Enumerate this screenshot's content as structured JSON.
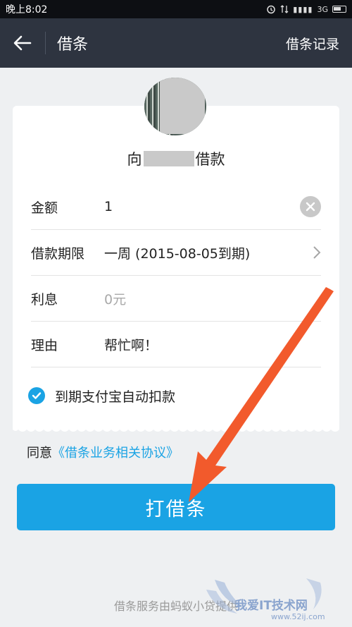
{
  "status_bar": {
    "time": "晚上8:02",
    "network": "3G"
  },
  "nav": {
    "title": "借条",
    "right_link": "借条记录"
  },
  "lender": {
    "prefix": "向",
    "suffix": "借款"
  },
  "form": {
    "amount_label": "金额",
    "amount_value": "1",
    "term_label": "借款期限",
    "term_value": "一周 (2015-08-05到期)",
    "interest_label": "利息",
    "interest_value": "0元",
    "reason_label": "理由",
    "reason_value": "帮忙啊！"
  },
  "autopay": {
    "label": "到期支付宝自动扣款",
    "checked": true
  },
  "agreement": {
    "prefix": "同意",
    "link": "《借条业务相关协议》"
  },
  "primary_button": "打借条",
  "footer": "借条服务由蚂蚁小贷提供",
  "watermark": {
    "text": "我爱IT技术网",
    "url": "www.52ij.com"
  },
  "colors": {
    "accent": "#1aa3e4",
    "nav_bg": "#2e3440",
    "annotation": "#f25a2c"
  }
}
